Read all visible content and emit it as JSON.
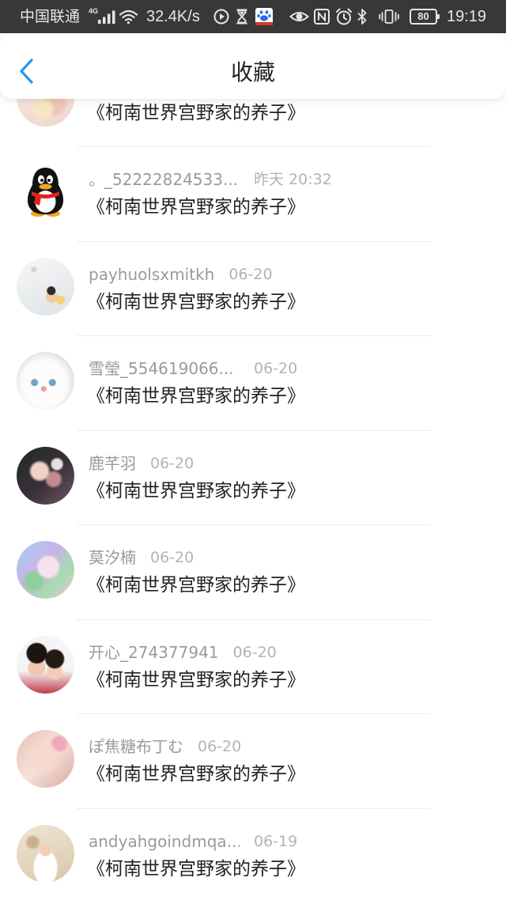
{
  "status_bar": {
    "carrier": "中国联通",
    "network_type": "4G",
    "net_speed": "32.4K/s",
    "battery_level": "80",
    "time": "19:19",
    "icons": [
      "signal-icon",
      "wifi-icon",
      "play-icon",
      "hourglass-icon",
      "baidu-app-icon",
      "eye-icon",
      "nfc-icon",
      "alarm-icon",
      "bluetooth-icon",
      "vibrate-icon",
      "battery-icon"
    ]
  },
  "header": {
    "back_icon": "chevron-left-icon",
    "title": "收藏"
  },
  "favorites": [
    {
      "title": "《柯南世界宫野家的养子》"
    },
    {
      "user": "。_52222824533...",
      "time": "昨天 20:32",
      "title": "《柯南世界宫野家的养子》"
    },
    {
      "user": "payhuolsxmitkh",
      "time": "06-20",
      "title": "《柯南世界宫野家的养子》"
    },
    {
      "user": "雪瑩_554619066...",
      "time": "06-20",
      "title": "《柯南世界宫野家的养子》"
    },
    {
      "user": "鹿芊羽",
      "time": "06-20",
      "title": "《柯南世界宫野家的养子》"
    },
    {
      "user": "莫汐楠",
      "time": "06-20",
      "title": "《柯南世界宫野家的养子》"
    },
    {
      "user": "开心_274377941",
      "time": "06-20",
      "title": "《柯南世界宫野家的养子》"
    },
    {
      "user": "ぽ焦糖布丁む",
      "time": "06-20",
      "title": "《柯南世界宫野家的养子》"
    },
    {
      "user": "andyahgoindmqa...",
      "time": "06-19",
      "title": "《柯南世界宫野家的养子》"
    }
  ],
  "colors": {
    "accent": "#2b95ea",
    "status_bar_bg": "#383838",
    "status_bar_fg": "#e6e6e6",
    "user_name_text": "#9a9a9a",
    "time_text": "#b3b3b3",
    "title_text": "#222222",
    "divider": "#ededed"
  }
}
